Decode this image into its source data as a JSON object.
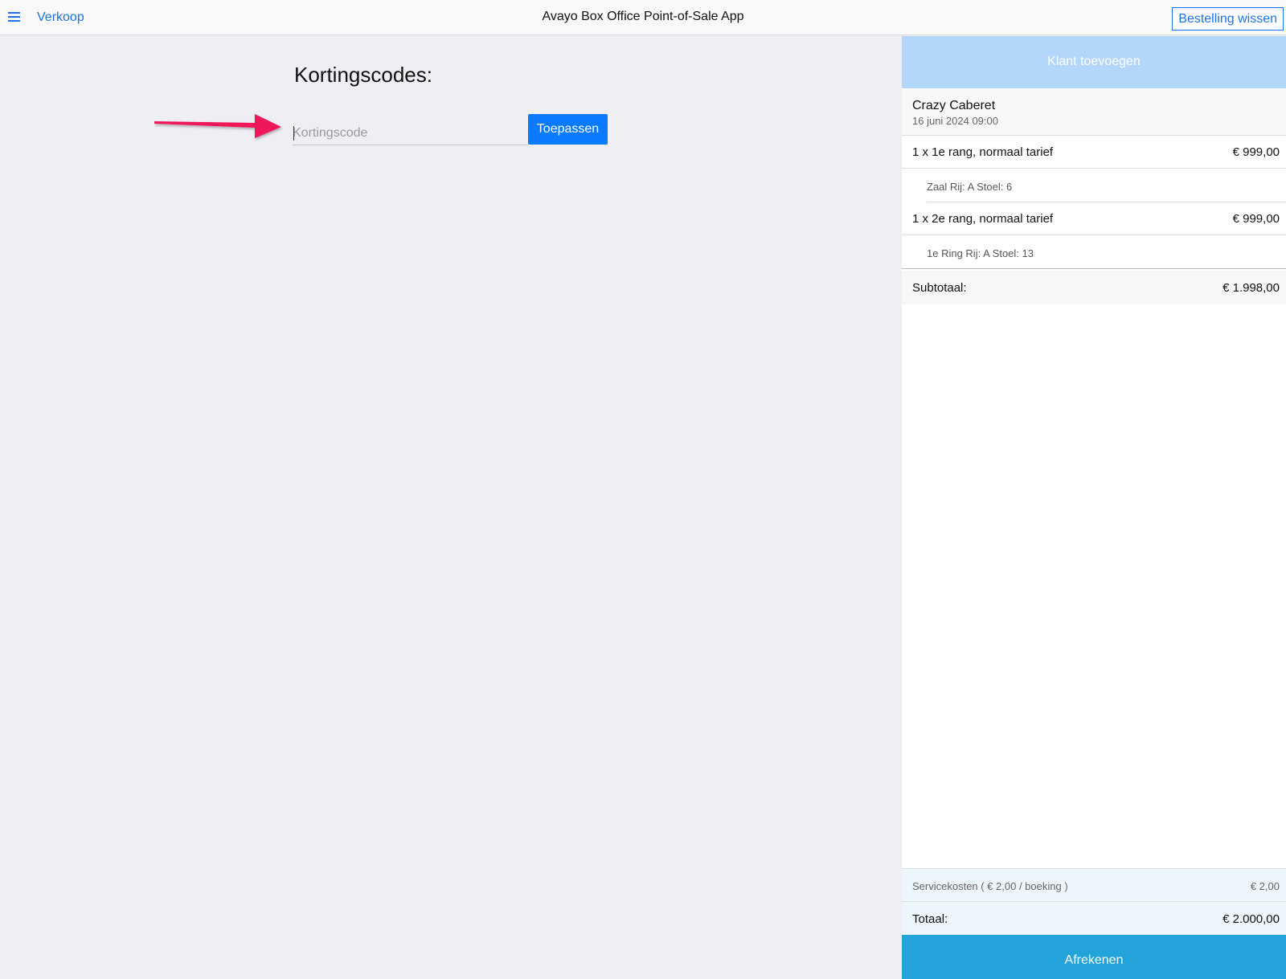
{
  "header": {
    "menu_icon": "hamburger-menu-icon",
    "nav_label": "Verkoop",
    "app_title": "Avayo Box Office Point-of-Sale App",
    "clear_order_label": "Bestelling wissen"
  },
  "discount": {
    "title": "Kortingscodes:",
    "input_placeholder": "Kortingscode",
    "input_value": "",
    "apply_label": "Toepassen",
    "annotation_icon": "arrow-right-icon"
  },
  "order": {
    "add_customer_label": "Klant toevoegen",
    "event_name": "Crazy Caberet",
    "event_date": "16 juni 2024 09:00",
    "items": [
      {
        "label": "1 x 1e rang, normaal tarief",
        "amount": "€ 999,00",
        "seat": "Zaal Rij: A Stoel: 6"
      },
      {
        "label": "1 x 2e rang, normaal tarief",
        "amount": "€ 999,00",
        "seat": "1e Ring Rij: A Stoel: 13"
      }
    ],
    "subtotal_label": "Subtotaal:",
    "subtotal_amount": "€ 1.998,00",
    "service_label": "Servicekosten ( € 2,00 / boeking )",
    "service_amount": "€ 2,00",
    "total_label": "Totaal:",
    "total_amount": "€ 2.000,00",
    "checkout_label": "Afrekenen"
  },
  "colors": {
    "accent": "#1a73e8",
    "apply_button": "#0a7bff",
    "add_customer": "#b3d6fb",
    "checkout": "#22a3da",
    "annotation_arrow": "#f0145a"
  }
}
